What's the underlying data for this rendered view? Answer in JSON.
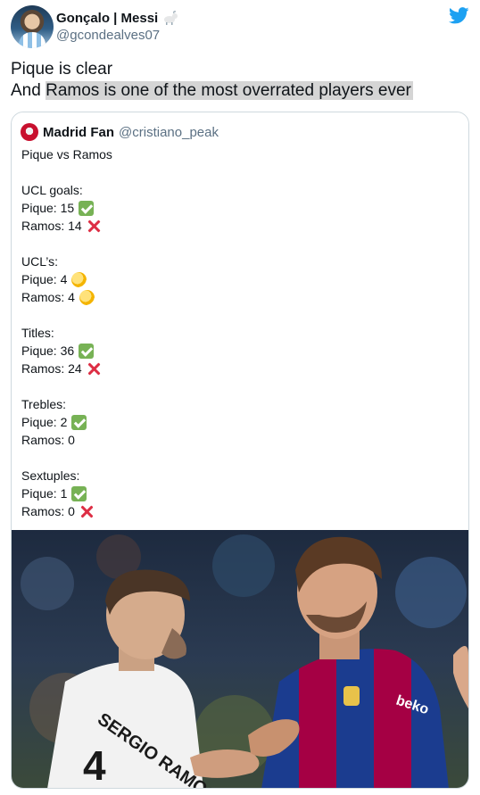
{
  "tweet": {
    "author_name": "Gonçalo | Messi",
    "author_handle": "@gcondealves07",
    "text_line1": "Pique is clear",
    "text_line2_plain": "And ",
    "text_line2_highlight": "Ramos is one of the most overrated players ever"
  },
  "quote": {
    "author_name": "Madrid Fan",
    "author_handle": "@cristiano_peak",
    "lines": [
      {
        "text": "Pique vs Ramos",
        "emoji": ""
      },
      {
        "text": "",
        "emoji": ""
      },
      {
        "text": "UCL goals:",
        "emoji": ""
      },
      {
        "text": "Pique: 15",
        "emoji": "check-emoji"
      },
      {
        "text": "Ramos: 14",
        "emoji": "cross-emoji"
      },
      {
        "text": "",
        "emoji": ""
      },
      {
        "text": "UCL’s:",
        "emoji": ""
      },
      {
        "text": "Pique: 4",
        "emoji": "handshake-emoji"
      },
      {
        "text": "Ramos: 4",
        "emoji": "handshake-emoji"
      },
      {
        "text": "",
        "emoji": ""
      },
      {
        "text": "Titles:",
        "emoji": ""
      },
      {
        "text": "Pique: 36",
        "emoji": "check-emoji"
      },
      {
        "text": "Ramos: 24",
        "emoji": "cross-emoji"
      },
      {
        "text": "",
        "emoji": ""
      },
      {
        "text": "Trebles:",
        "emoji": ""
      },
      {
        "text": "Pique: 2",
        "emoji": "check-emoji"
      },
      {
        "text": "Ramos: 0",
        "emoji": ""
      },
      {
        "text": "",
        "emoji": ""
      },
      {
        "text": "Sextuples:",
        "emoji": ""
      },
      {
        "text": "Pique: 1",
        "emoji": "check-emoji"
      },
      {
        "text": "Ramos: 0",
        "emoji": "cross-emoji"
      }
    ],
    "photo": {
      "left_jersey_text": "SERGIO RAMOS",
      "left_jersey_number": "4",
      "right_sponsor_text": "beko"
    }
  },
  "colors": {
    "twitter_blue": "#1da1f2",
    "handle_gray": "#5b7083",
    "highlight": "#d5d5d5"
  }
}
